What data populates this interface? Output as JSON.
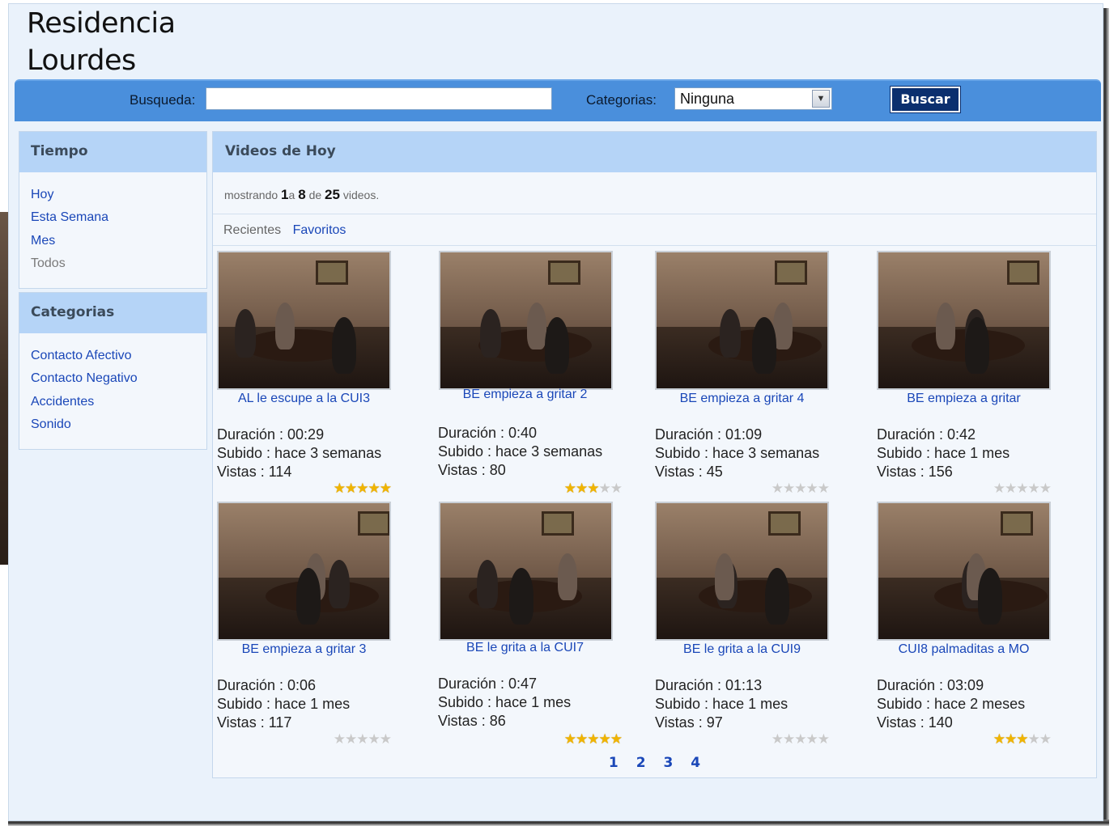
{
  "site": {
    "title_line1": "Residencia",
    "title_line2": "Lourdes"
  },
  "search": {
    "label": "Busqueda:",
    "value": "",
    "placeholder": "",
    "categories_label": "Categorias:",
    "categories_selected": "Ninguna",
    "button_label": "Buscar"
  },
  "sidebar": {
    "tiempo": {
      "title": "Tiempo",
      "items": [
        {
          "label": "Hoy"
        },
        {
          "label": "Esta Semana"
        },
        {
          "label": "Mes"
        },
        {
          "label": "Todos"
        }
      ]
    },
    "categorias": {
      "title": "Categorias",
      "items": [
        {
          "label": "Contacto Afectivo"
        },
        {
          "label": "Contacto Negativo"
        },
        {
          "label": "Accidentes"
        },
        {
          "label": "Sonido"
        }
      ]
    }
  },
  "main": {
    "title": "Videos de Hoy",
    "count": {
      "prefix": "mostrando",
      "from": "1",
      "a": "a",
      "to": "8",
      "de": "de",
      "total": "25",
      "suffix": "videos."
    },
    "tabs": {
      "recent": "Recientes",
      "favorites": "Favoritos"
    },
    "videos": [
      {
        "title": "AL le escupe a la CUI3",
        "duration": "Duración : 00:29",
        "uploaded": "Subido : hace 3 semanas",
        "views": "Vistas : 114",
        "rating": 5
      },
      {
        "title": "BE empieza a gritar 2",
        "duration": "Duración : 0:40",
        "uploaded": "Subido : hace 3 semanas",
        "views": "Vistas : 80",
        "rating": 3
      },
      {
        "title": "BE empieza a gritar 4",
        "duration": "Duración : 01:09",
        "uploaded": "Subido : hace 3 semanas",
        "views": "Vistas : 45",
        "rating": 0
      },
      {
        "title": "BE empieza a gritar",
        "duration": "Duración : 0:42",
        "uploaded": "Subido : hace 1 mes",
        "views": "Vistas : 156",
        "rating": 0
      },
      {
        "title": "BE empieza a gritar 3",
        "duration": "Duración : 0:06",
        "uploaded": "Subido : hace 1 mes",
        "views": "Vistas : 117",
        "rating": 0
      },
      {
        "title": "BE le grita a la CUI7",
        "duration": "Duración : 0:47",
        "uploaded": "Subido : hace 1 mes",
        "views": "Vistas : 86",
        "rating": 5
      },
      {
        "title": "BE le grita a la CUI9",
        "duration": "Duración : 01:13",
        "uploaded": "Subido : hace 1 mes",
        "views": "Vistas : 97",
        "rating": 0
      },
      {
        "title": "CUI8 palmaditas a MO",
        "duration": "Duración : 03:09",
        "uploaded": "Subido : hace 2 meses",
        "views": "Vistas : 140",
        "rating": 3
      }
    ],
    "pages": [
      "1",
      "2",
      "3",
      "4"
    ]
  },
  "colors": {
    "accent": "#4a8fdc",
    "link": "#1a47b8",
    "button": "#0b2f6e",
    "panel_header": "#b5d4f7",
    "star_on": "#f0b400",
    "star_off": "#c9c9c9"
  }
}
